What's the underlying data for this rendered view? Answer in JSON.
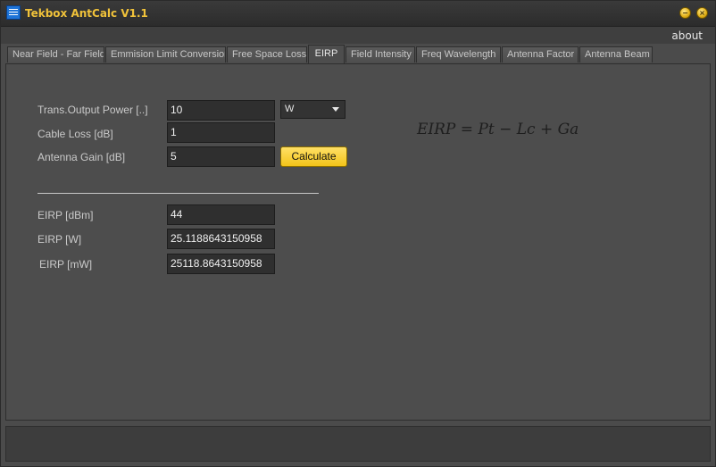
{
  "window": {
    "title": "Tekbox AntCalc V1.1"
  },
  "menu": {
    "about": "about"
  },
  "tabs": [
    {
      "label": "Near Field - Far Field"
    },
    {
      "label": "Emmision Limit Conversion"
    },
    {
      "label": "Free Space Loss"
    },
    {
      "label": "EIRP"
    },
    {
      "label": "Field Intensity"
    },
    {
      "label": "Freq Wavelength"
    },
    {
      "label": "Antenna Factor"
    },
    {
      "label": "Antenna Beam"
    }
  ],
  "inputs": {
    "trans_power_label": "Trans.Output Power [..]",
    "trans_power_value": "10",
    "unit_selected": "W",
    "cable_loss_label": "Cable Loss [dB]",
    "cable_loss_value": "1",
    "antenna_gain_label": "Antenna Gain [dB]",
    "antenna_gain_value": "5",
    "calculate_label": "Calculate"
  },
  "formula": "EIRP = Pt − Lc + Ga",
  "results": {
    "eirp_dbm_label": "EIRP [dBm]",
    "eirp_dbm_value": "44",
    "eirp_w_label": "EIRP [W]",
    "eirp_w_value": "25.1188643150958",
    "eirp_mw_label": "EIRP [mW]",
    "eirp_mw_value": "25118.8643150958"
  }
}
